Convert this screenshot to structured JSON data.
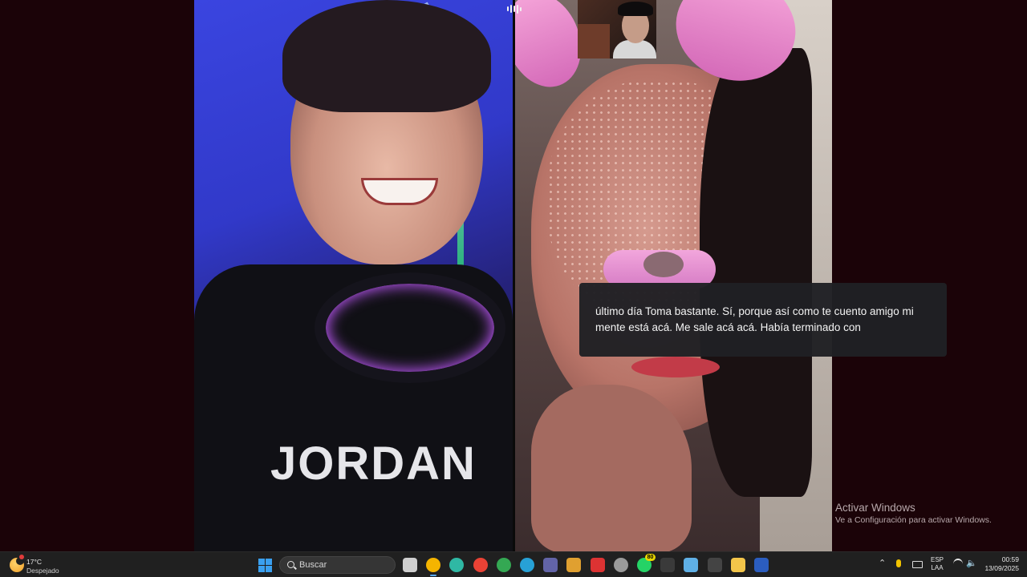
{
  "caption": {
    "text": "último día Toma bastante. Sí, porque así como te cuento amigo mi mente está acá. Me sale acá acá. Había terminado con"
  },
  "shirt_print": "JORDAN",
  "watermark": {
    "title": "Activar Windows",
    "subtitle": "Ve a Configuración para activar Windows."
  },
  "taskbar": {
    "weather": {
      "temp": "17°C",
      "condition": "Despejado"
    },
    "search_placeholder": "Buscar",
    "apps": [
      {
        "name": "task-view",
        "icon": "task-view-icon",
        "color": "#cfcfcf"
      },
      {
        "name": "chrome-dev",
        "icon": "chrome-icon",
        "color": "#f5b400",
        "active": true
      },
      {
        "name": "edge",
        "icon": "edge-icon",
        "color": "#2fb8a4"
      },
      {
        "name": "chrome",
        "icon": "chrome-icon",
        "color": "#e94235"
      },
      {
        "name": "chrome-2",
        "icon": "chrome-icon",
        "color": "#34a853"
      },
      {
        "name": "edge-2",
        "icon": "edge-icon",
        "color": "#27a1d6"
      },
      {
        "name": "teams",
        "icon": "teams-icon",
        "color": "#6264a7"
      },
      {
        "name": "app-7",
        "icon": "app-icon",
        "color": "#e0a030"
      },
      {
        "name": "app-8",
        "icon": "app-icon",
        "color": "#d33"
      },
      {
        "name": "settings",
        "icon": "gear-icon",
        "color": "#9a9a9a"
      },
      {
        "name": "whatsapp",
        "icon": "whatsapp-icon",
        "color": "#25d366",
        "badge": "80"
      },
      {
        "name": "terminal",
        "icon": "terminal-icon",
        "color": "#3a3a3a"
      },
      {
        "name": "notepad",
        "icon": "notepad-icon",
        "color": "#5fb0e6"
      },
      {
        "name": "app-13",
        "icon": "app-icon",
        "color": "#444"
      },
      {
        "name": "file-explorer",
        "icon": "folder-icon",
        "color": "#f3c54a"
      },
      {
        "name": "word",
        "icon": "word-icon",
        "color": "#2b5dbf"
      }
    ],
    "language": {
      "line1": "ESP",
      "line2": "LAA"
    },
    "clock": {
      "time": "00:59",
      "date": "13/09/2025"
    }
  }
}
